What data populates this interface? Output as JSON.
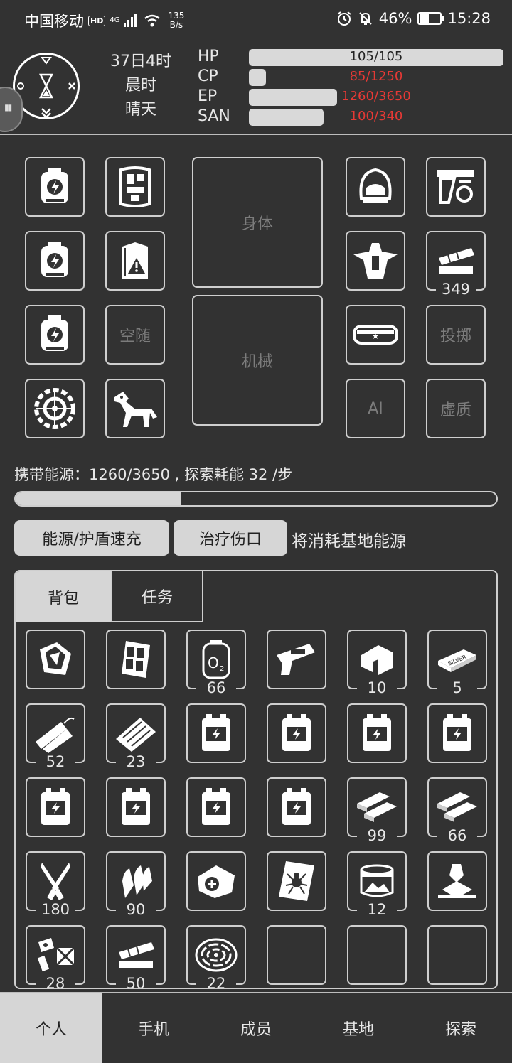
{
  "status_bar": {
    "carrier": "中国移动",
    "hd": "HD",
    "network": "4G",
    "speed_value": "135",
    "speed_unit": "B/s",
    "battery": "46%",
    "battery_level": 0.46,
    "time": "15:28"
  },
  "header": {
    "day": "37日4时",
    "period": "晨时",
    "weather": "晴天",
    "stats": [
      {
        "label": "HP",
        "text": "105/105",
        "ratio": 1.0,
        "text_color": "#222222"
      },
      {
        "label": "CP",
        "text": "85/1250",
        "ratio": 0.068,
        "text_color": "#e53935"
      },
      {
        "label": "EP",
        "text": "1260/3650",
        "ratio": 0.345,
        "text_color": "#e53935"
      },
      {
        "label": "SAN",
        "text": "100/340",
        "ratio": 0.294,
        "text_color": "#e53935"
      }
    ]
  },
  "equipment": {
    "body_label": "身体",
    "mech_label": "机械",
    "empty_follow": "空随",
    "throw": "投掷",
    "ai": "AI",
    "ether": "虚质",
    "ammo_count": "349"
  },
  "energy": {
    "text": "携带能源：1260/3650 , 探索耗能 32 /步",
    "ratio": 0.345
  },
  "actions": {
    "recharge": "能源/护盾速充",
    "heal": "治疗伤口",
    "note": "将消耗基地能源"
  },
  "inventory": {
    "tabs": [
      "背包",
      "任务"
    ],
    "counts": {
      "r1c3": "66",
      "r1c5": "10",
      "r1c6": "5",
      "r2c1": "52",
      "r2c2": "23",
      "r3c5": "99",
      "r3c6": "66",
      "r4c1": "180",
      "r4c2": "90",
      "r4c5": "12",
      "r5c1": "28",
      "r5c2": "50",
      "r5c3": "22"
    }
  },
  "nav": [
    "个人",
    "手机",
    "成员",
    "基地",
    "探索"
  ]
}
